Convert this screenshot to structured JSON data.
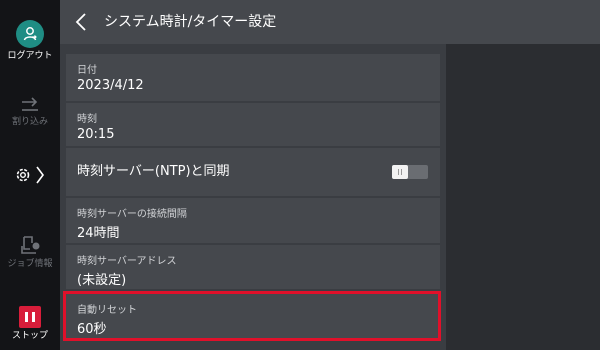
{
  "rail": {
    "logout_label": "ログアウト",
    "interrupt_label": "割り込み",
    "job_status_label": "ジョブ情報",
    "stop_label": "ストップ"
  },
  "header": {
    "title": "システム時計/タイマー設定"
  },
  "settings": {
    "date": {
      "label": "日付",
      "value": "2023/4/12"
    },
    "time": {
      "label": "時刻",
      "value": "20:15"
    },
    "ntp_sync": {
      "label": "時刻サーバー(NTP)と同期",
      "enabled": false
    },
    "connect_interval": {
      "label": "時刻サーバーの接続間隔",
      "value": "24時間"
    },
    "server_address": {
      "label": "時刻サーバーアドレス",
      "value": "(未設定)"
    },
    "auto_reset": {
      "label": "自動リセット",
      "value": "60秒"
    }
  },
  "colors": {
    "accent_teal": "#1f8d84",
    "stop_red": "#d81d3a",
    "highlight_red": "#e0102a"
  }
}
